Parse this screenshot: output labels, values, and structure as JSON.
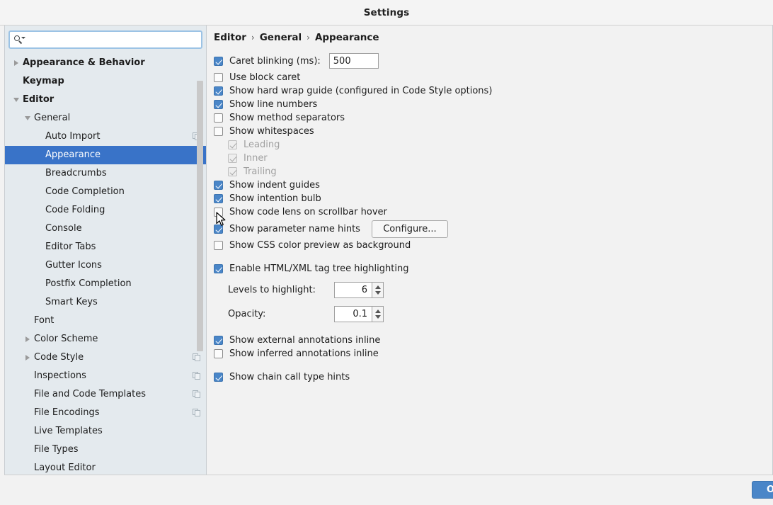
{
  "window": {
    "title": "Settings"
  },
  "search": {
    "value": "",
    "placeholder": "",
    "icon": "search-icon"
  },
  "sidebar": {
    "items": [
      {
        "label": "Appearance & Behavior",
        "indent": 0,
        "bold": true,
        "twisty": "right",
        "selected": false,
        "badge": false
      },
      {
        "label": "Keymap",
        "indent": 0,
        "bold": true,
        "twisty": "none",
        "selected": false,
        "badge": false
      },
      {
        "label": "Editor",
        "indent": 0,
        "bold": true,
        "twisty": "down",
        "selected": false,
        "badge": false
      },
      {
        "label": "General",
        "indent": 1,
        "bold": false,
        "twisty": "down",
        "selected": false,
        "badge": false
      },
      {
        "label": "Auto Import",
        "indent": 2,
        "bold": false,
        "twisty": "none",
        "selected": false,
        "badge": true
      },
      {
        "label": "Appearance",
        "indent": 2,
        "bold": false,
        "twisty": "none",
        "selected": true,
        "badge": false
      },
      {
        "label": "Breadcrumbs",
        "indent": 2,
        "bold": false,
        "twisty": "none",
        "selected": false,
        "badge": false
      },
      {
        "label": "Code Completion",
        "indent": 2,
        "bold": false,
        "twisty": "none",
        "selected": false,
        "badge": false
      },
      {
        "label": "Code Folding",
        "indent": 2,
        "bold": false,
        "twisty": "none",
        "selected": false,
        "badge": false
      },
      {
        "label": "Console",
        "indent": 2,
        "bold": false,
        "twisty": "none",
        "selected": false,
        "badge": false
      },
      {
        "label": "Editor Tabs",
        "indent": 2,
        "bold": false,
        "twisty": "none",
        "selected": false,
        "badge": false
      },
      {
        "label": "Gutter Icons",
        "indent": 2,
        "bold": false,
        "twisty": "none",
        "selected": false,
        "badge": false
      },
      {
        "label": "Postfix Completion",
        "indent": 2,
        "bold": false,
        "twisty": "none",
        "selected": false,
        "badge": false
      },
      {
        "label": "Smart Keys",
        "indent": 2,
        "bold": false,
        "twisty": "none",
        "selected": false,
        "badge": false
      },
      {
        "label": "Font",
        "indent": 1,
        "bold": false,
        "twisty": "none",
        "selected": false,
        "badge": false
      },
      {
        "label": "Color Scheme",
        "indent": 1,
        "bold": false,
        "twisty": "right",
        "selected": false,
        "badge": false
      },
      {
        "label": "Code Style",
        "indent": 1,
        "bold": false,
        "twisty": "right",
        "selected": false,
        "badge": true
      },
      {
        "label": "Inspections",
        "indent": 1,
        "bold": false,
        "twisty": "none",
        "selected": false,
        "badge": true
      },
      {
        "label": "File and Code Templates",
        "indent": 1,
        "bold": false,
        "twisty": "none",
        "selected": false,
        "badge": true
      },
      {
        "label": "File Encodings",
        "indent": 1,
        "bold": false,
        "twisty": "none",
        "selected": false,
        "badge": true
      },
      {
        "label": "Live Templates",
        "indent": 1,
        "bold": false,
        "twisty": "none",
        "selected": false,
        "badge": false
      },
      {
        "label": "File Types",
        "indent": 1,
        "bold": false,
        "twisty": "none",
        "selected": false,
        "badge": false
      },
      {
        "label": "Layout Editor",
        "indent": 1,
        "bold": false,
        "twisty": "none",
        "selected": false,
        "badge": false
      }
    ]
  },
  "breadcrumb": {
    "parts": [
      "Editor",
      "General",
      "Appearance"
    ],
    "separator": "›"
  },
  "settings": {
    "caret_blinking": {
      "label": "Caret blinking (ms):",
      "checked": true,
      "value": "500"
    },
    "use_block_caret": {
      "label": "Use block caret",
      "checked": false
    },
    "show_hard_wrap_guide": {
      "label": "Show hard wrap guide (configured in Code Style options)",
      "checked": true
    },
    "show_line_numbers": {
      "label": "Show line numbers",
      "checked": true
    },
    "show_method_separators": {
      "label": "Show method separators",
      "checked": false
    },
    "show_whitespaces": {
      "label": "Show whitespaces",
      "checked": false
    },
    "ws_leading": {
      "label": "Leading",
      "checked": true,
      "disabled": true
    },
    "ws_inner": {
      "label": "Inner",
      "checked": true,
      "disabled": true
    },
    "ws_trailing": {
      "label": "Trailing",
      "checked": true,
      "disabled": true
    },
    "show_indent_guides": {
      "label": "Show indent guides",
      "checked": true
    },
    "show_intention_bulb": {
      "label": "Show intention bulb",
      "checked": true
    },
    "show_code_lens": {
      "label": "Show code lens on scrollbar hover",
      "checked": false
    },
    "show_param_hints": {
      "label": "Show parameter name hints",
      "checked": true,
      "button": "Configure..."
    },
    "show_css_color_preview": {
      "label": "Show CSS color preview as background",
      "checked": false
    },
    "enable_tag_tree": {
      "label": "Enable HTML/XML tag tree highlighting",
      "checked": true
    },
    "levels_to_highlight": {
      "label": "Levels to highlight:",
      "value": "6"
    },
    "opacity": {
      "label": "Opacity:",
      "value": "0.1"
    },
    "show_external_annotations": {
      "label": "Show external annotations inline",
      "checked": true
    },
    "show_inferred_annotations": {
      "label": "Show inferred annotations inline",
      "checked": false
    },
    "show_chain_call_hints": {
      "label": "Show chain call type hints",
      "checked": true
    }
  },
  "footer": {
    "ok_label": "OK"
  },
  "colors": {
    "accent": "#3973c8",
    "checkbox": "#4a86c8",
    "sidebar_bg": "#e4eaee",
    "panel_bg": "#f2f2f2"
  }
}
